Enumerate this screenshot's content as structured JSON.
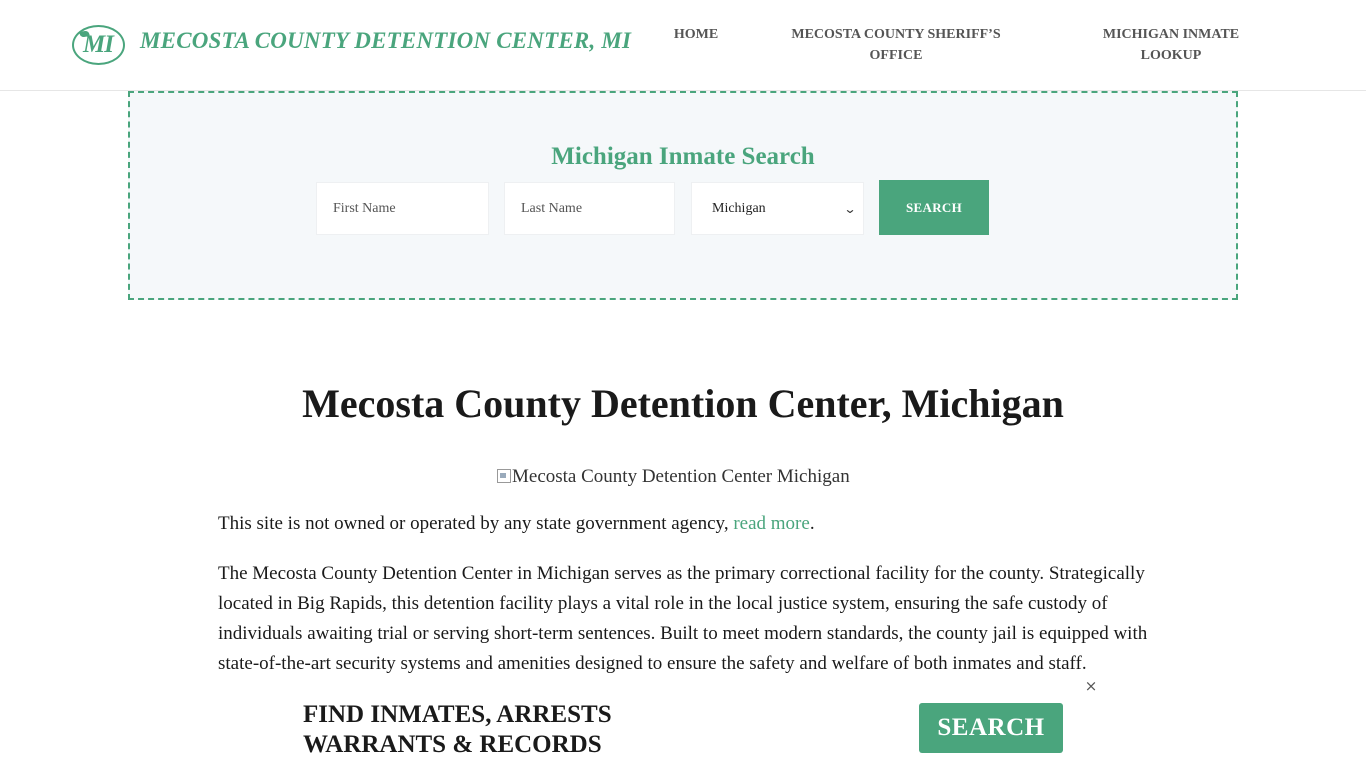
{
  "header": {
    "logo_text": "MI",
    "site_title": "MECOSTA COUNTY DETENTION CENTER, MI",
    "nav": [
      {
        "label": "HOME"
      },
      {
        "label": "MECOSTA COUNTY SHERIFF’S OFFICE"
      },
      {
        "label": "MICHIGAN INMATE LOOKUP"
      }
    ]
  },
  "search": {
    "title": "Michigan Inmate Search",
    "first_name_placeholder": "First Name",
    "last_name_placeholder": "Last Name",
    "state_selected": "Michigan",
    "button_label": "SEARCH"
  },
  "main": {
    "title": "Mecosta County Detention Center, Michigan",
    "image_alt": "Mecosta County Detention Center Michigan",
    "disclaimer_text": "This site is not owned or operated by any state government agency, ",
    "disclaimer_link": "read more",
    "disclaimer_end": ".",
    "paragraph": "The Mecosta County Detention Center in Michigan serves as the primary correctional facility for the county. Strategically located in Big Rapids, this detention facility plays a vital role in the local justice system, ensuring the safe custody of individuals awaiting trial or serving short-term sentences. Built to meet modern standards, the county jail is equipped with state-of-the-art security systems and amenities designed to ensure the safety and welfare of both inmates and staff."
  },
  "banner": {
    "line1": "FIND INMATES, ARRESTS",
    "line2": "WARRANTS & RECORDS",
    "button_label": "SEARCH",
    "close_glyph": "×"
  },
  "colors": {
    "accent": "#4aa57d",
    "search_bg": "#f5f8fa"
  }
}
